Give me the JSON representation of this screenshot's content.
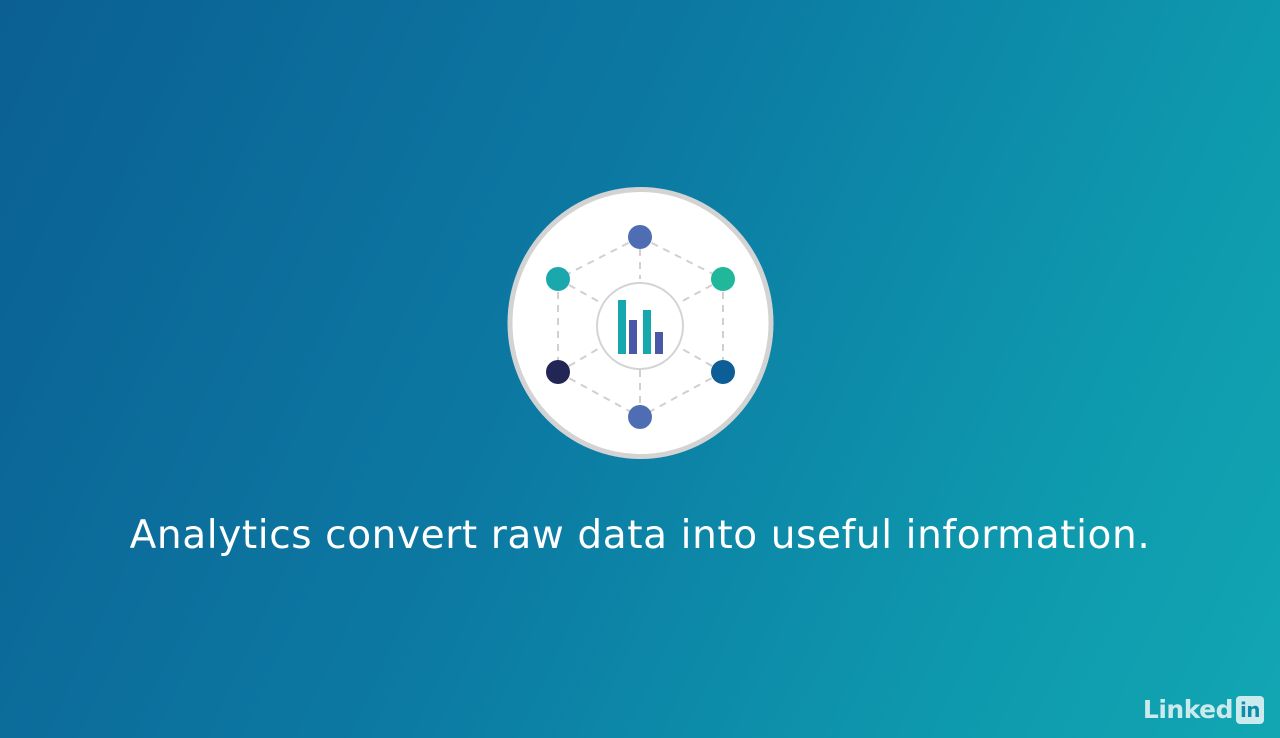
{
  "caption": "Analytics convert raw data into useful information.",
  "logo": {
    "word": "Linked",
    "box_text": "in"
  },
  "colors": {
    "background_start": "#0b5f93",
    "background_end": "#12a6b2",
    "node_blue": "#4f6db3",
    "node_teal": "#1aa8ad",
    "node_green": "#20b79a",
    "node_navy": "#222654",
    "node_dark_blue": "#0d5e96",
    "bar_teal": "#16a8ac",
    "bar_indigo": "#4a59a7"
  }
}
